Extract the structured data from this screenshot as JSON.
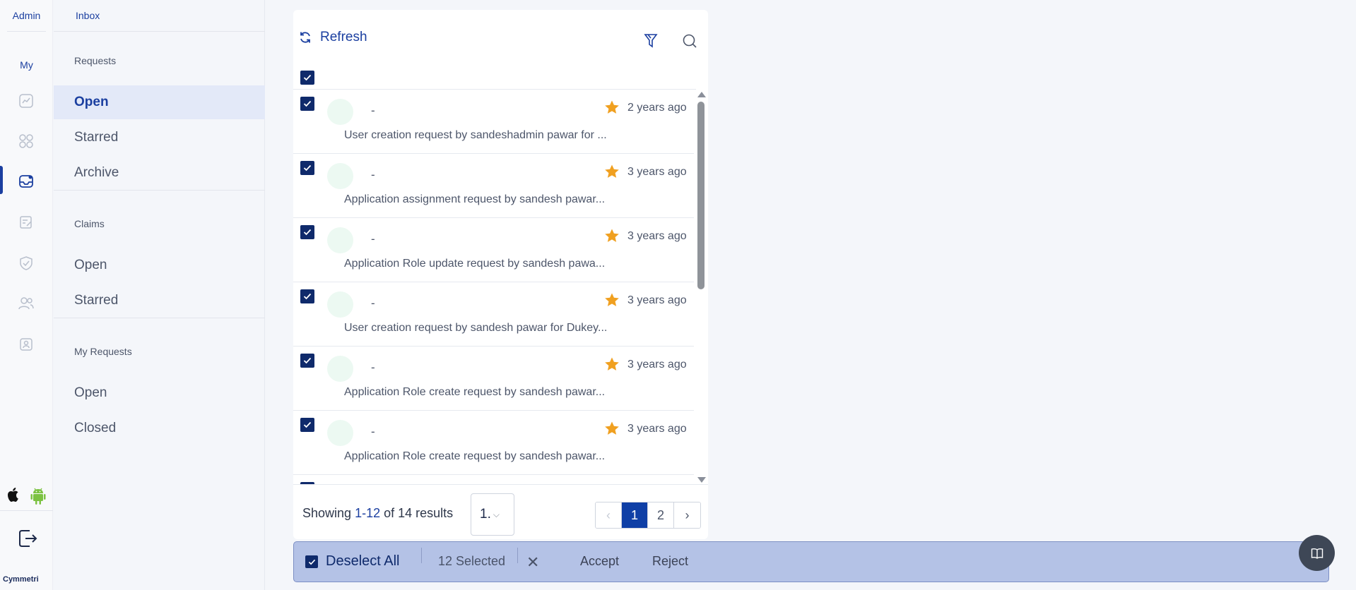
{
  "rail": {
    "admin_label": "Admin",
    "my_label": "My",
    "brand": "Cymmetri",
    "icons": [
      "dashboard-icon",
      "apps-grid-icon",
      "inbox-icon",
      "review-icon",
      "shield-check-icon",
      "users-icon",
      "identity-badge-icon"
    ],
    "active_icon": "inbox-icon",
    "accent_color": "#1b3fa0"
  },
  "nav": {
    "title": "Inbox",
    "requests": {
      "heading": "Requests",
      "items": [
        "Open",
        "Starred",
        "Archive"
      ],
      "active": "Open"
    },
    "claims": {
      "heading": "Claims",
      "items": [
        "Open",
        "Starred"
      ]
    },
    "my_requests": {
      "heading": "My Requests",
      "items": [
        "Open",
        "Closed"
      ]
    }
  },
  "toolbar": {
    "refresh_label": "Refresh",
    "filter_icon": "filter-icon",
    "search_icon": "search-icon"
  },
  "list": {
    "select_all_checked": true,
    "rows": [
      {
        "name": "-",
        "starred": true,
        "time": "2 years ago",
        "description": "User creation request by sandeshadmin pawar for ..."
      },
      {
        "name": "-",
        "starred": true,
        "time": "3 years ago",
        "description": "Application assignment request by sandesh pawar..."
      },
      {
        "name": "-",
        "starred": true,
        "time": "3 years ago",
        "description": "Application Role update request by sandesh pawa..."
      },
      {
        "name": "-",
        "starred": true,
        "time": "3 years ago",
        "description": "User creation request by sandesh pawar for Dukey..."
      },
      {
        "name": "-",
        "starred": true,
        "time": "3 years ago",
        "description": "Application Role create request by sandesh pawar..."
      },
      {
        "name": "-",
        "starred": true,
        "time": "3 years ago",
        "description": "Application Role create request by sandesh pawar..."
      }
    ],
    "star_color": "#f0a020"
  },
  "footer": {
    "showing_prefix": "Showing",
    "showing_range": "1-12",
    "showing_suffix": "of 14 results",
    "per_page_value": "1.",
    "pages": [
      "1",
      "2"
    ],
    "current_page": "1"
  },
  "actionbar": {
    "deselect_label": "Deselect All",
    "selected_label": "12 Selected",
    "close_glyph": "✕",
    "accept_label": "Accept",
    "reject_label": "Reject"
  }
}
